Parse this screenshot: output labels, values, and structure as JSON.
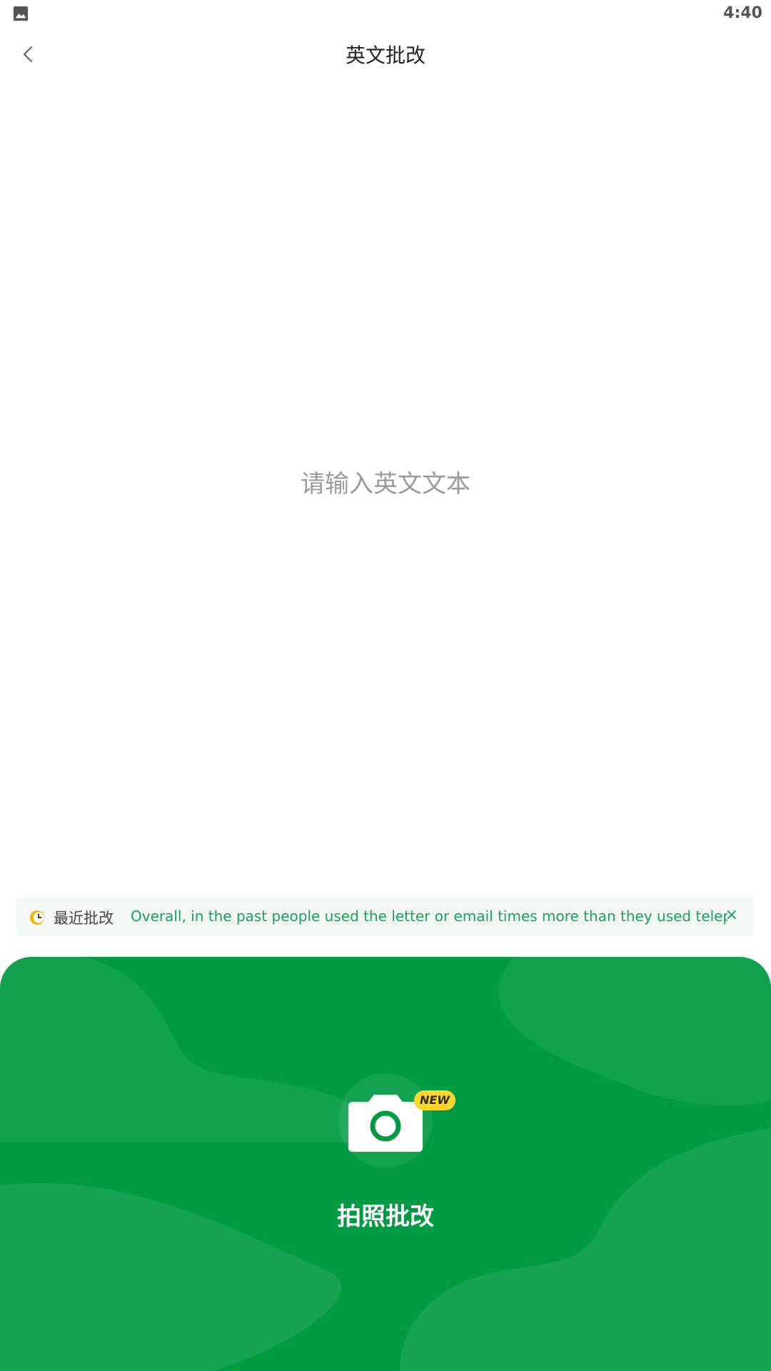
{
  "status_bar": {
    "time": "4:40",
    "notification_icon": "gallery-icon"
  },
  "header": {
    "title": "英文批改",
    "back_icon": "chevron-left-icon"
  },
  "editor": {
    "placeholder": "请输入英文文本",
    "value": ""
  },
  "recent": {
    "label": "最近批改",
    "text": "Overall, in the past people used the letter or email times more than they used telephon…",
    "close_label": "×",
    "icon": "clock-icon"
  },
  "camera": {
    "label": "拍照批改",
    "badge": "NEW",
    "icon": "camera-icon"
  },
  "colors": {
    "primary_green": "#009a42",
    "accent_green": "#1aa15b",
    "badge_yellow": "#ffd62c"
  }
}
